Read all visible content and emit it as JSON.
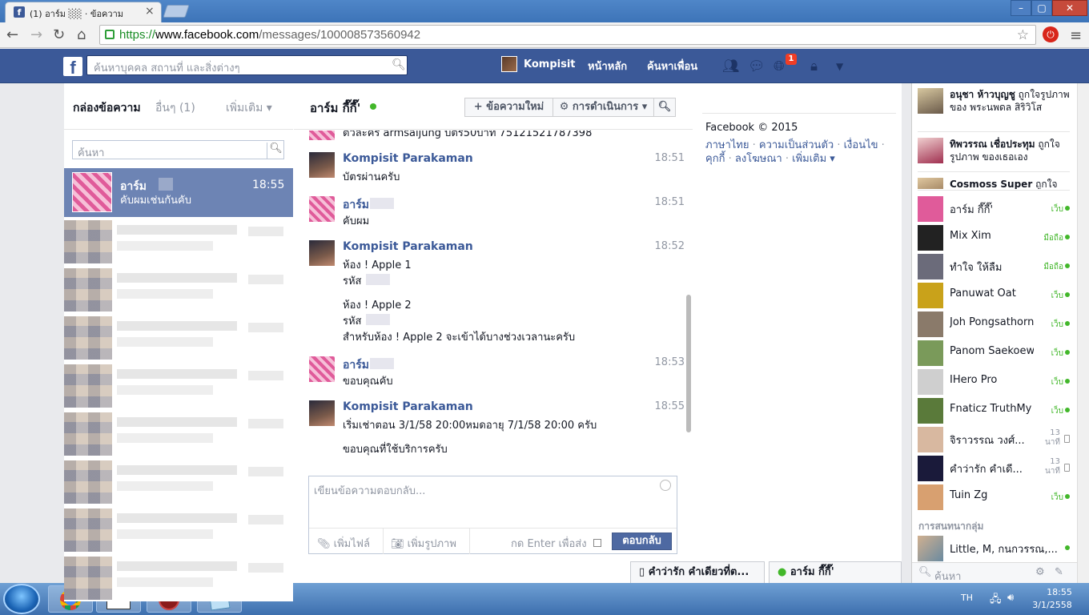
{
  "browser": {
    "tab_title": "(1) อาร์ม ░░ · ข้อความ",
    "url_scheme": "https://",
    "url_host": "www.facebook.com",
    "url_path": "/messages/100008573560942"
  },
  "fb": {
    "search_placeholder": "ค้นหาบุคคล สถานที่ และสิ่งต่างๆ",
    "user": "Kompisit",
    "home": "หน้าหลัก",
    "find_friends": "ค้นหาเพื่อน",
    "notif_count": "1"
  },
  "inbox": {
    "title": "กล่องข้อความ",
    "other": "อื่นๆ (1)",
    "more": "เพิ่มเติม ▾",
    "search_placeholder": "ค้นหา",
    "selected": {
      "name": "อาร์ม",
      "time": "18:55",
      "snippet": "คับผมเช่นกันคับ"
    }
  },
  "conversation": {
    "name": "อาร์ม กี๊กี๊'",
    "new_message": "+ ข้อความใหม่",
    "actions": "⚙ การดำเนินการ ▾",
    "search_icon": "search-icon",
    "messages": [
      {
        "sender": "",
        "time": "",
        "lines": [
          "ตัวละคร armsaijung บัตร50บาท 75121521787398"
        ],
        "av": "a"
      },
      {
        "sender": "Kompisit Parakaman",
        "time": "18:51",
        "lines": [
          "บัตรผ่านครับ"
        ],
        "av": "k"
      },
      {
        "sender": "อาร์ม",
        "time": "18:51",
        "lines": [
          "คับผม"
        ],
        "av": "a"
      },
      {
        "sender": "Kompisit Parakaman",
        "time": "18:52",
        "lines": [
          "ห้อง ! Apple 1",
          "รหัส",
          "",
          "ห้อง ! Apple 2",
          "รหัส",
          "สำหรับห้อง ! Apple 2 จะเข้าได้บางช่วงเวลานะครับ"
        ],
        "av": "k"
      },
      {
        "sender": "อาร์ม",
        "time": "18:53",
        "lines": [
          "ขอบคุณคับ"
        ],
        "av": "a"
      },
      {
        "sender": "Kompisit Parakaman",
        "time": "18:55",
        "lines": [
          "เริ่มเช่าตอน 3/1/58 20:00หมดอายุ 7/1/58 20:00 ครับ",
          "",
          "ขอบคุณที่ใช้บริการครับ"
        ],
        "av": "k"
      }
    ]
  },
  "composer": {
    "placeholder": "เขียนข้อความตอบกลับ...",
    "add_file": "เพิ่มไฟล์",
    "add_photo": "เพิ่มรูปภาพ",
    "enter_to_send": "กด Enter เพื่อส่ง",
    "reply": "ตอบกลับ"
  },
  "footer": {
    "copyright": "Facebook © 2015",
    "links": [
      "ภาษาไทย",
      "ความเป็นส่วนตัว",
      "เงื่อนไข",
      "คุกกี้",
      "ลงโฆษณา",
      "เพิ่มเติม ▾"
    ]
  },
  "ticker": [
    {
      "name": "อนุชา ห้าวบุญชู",
      "rest": " ถูกใจรูปภาพ ของ พระนพดล สิริวิโส"
    },
    {
      "name": "ทิพวรรณ เชื่อประทุม",
      "rest": " ถูกใจรูปภาพ ของเธอเอง"
    },
    {
      "name": "Cosmoss Super",
      "rest": " ถูกใจ"
    }
  ],
  "chat_list": [
    {
      "name": "อาร์ม กี๊กี๊'",
      "status": "เว็บ",
      "type": "web",
      "color": "#e05b9a"
    },
    {
      "name": "Mix Xim",
      "status": "มือถือ",
      "type": "web",
      "color": "#222222"
    },
    {
      "name": "ทำใจ ให้ลืม",
      "status": "มือถือ",
      "type": "web",
      "color": "#6b6b7a"
    },
    {
      "name": "Panuwat Oat",
      "status": "เว็บ",
      "type": "web",
      "color": "#c9a21a"
    },
    {
      "name": "Joh Pongsathorn",
      "status": "เว็บ",
      "type": "web",
      "color": "#8a7a6a"
    },
    {
      "name": "Panom Saekoew",
      "status": "เว็บ",
      "type": "web",
      "color": "#7a9a5a"
    },
    {
      "name": "IHero Pro",
      "status": "เว็บ",
      "type": "web",
      "color": "#cfcfcf"
    },
    {
      "name": "Fnaticz TruthMy",
      "status": "เว็บ",
      "type": "web",
      "color": "#5a7a3a"
    },
    {
      "name": "จิราวรรณ วงศ์...",
      "status": "13 นาที",
      "type": "idle",
      "color": "#d8b8a0"
    },
    {
      "name": "คำว่ารัก คำเดี...",
      "status": "13 นาที",
      "type": "idle",
      "color": "#1a1a3a"
    },
    {
      "name": "Tuin Zg",
      "status": "เว็บ",
      "type": "web",
      "color": "#d8a070"
    }
  ],
  "groups": {
    "title": "การสนทนากลุ่ม",
    "group1": "Little, M, กนกวรรณ,..."
  },
  "sidebar_search": "ค้นหา",
  "chat_tabs": [
    "คำว่ารัก คำเดียวที่ต...",
    "อาร์ม กี๊กี๊'"
  ],
  "taskbar": {
    "lang": "TH",
    "time": "18:55",
    "date": "3/1/2558"
  }
}
